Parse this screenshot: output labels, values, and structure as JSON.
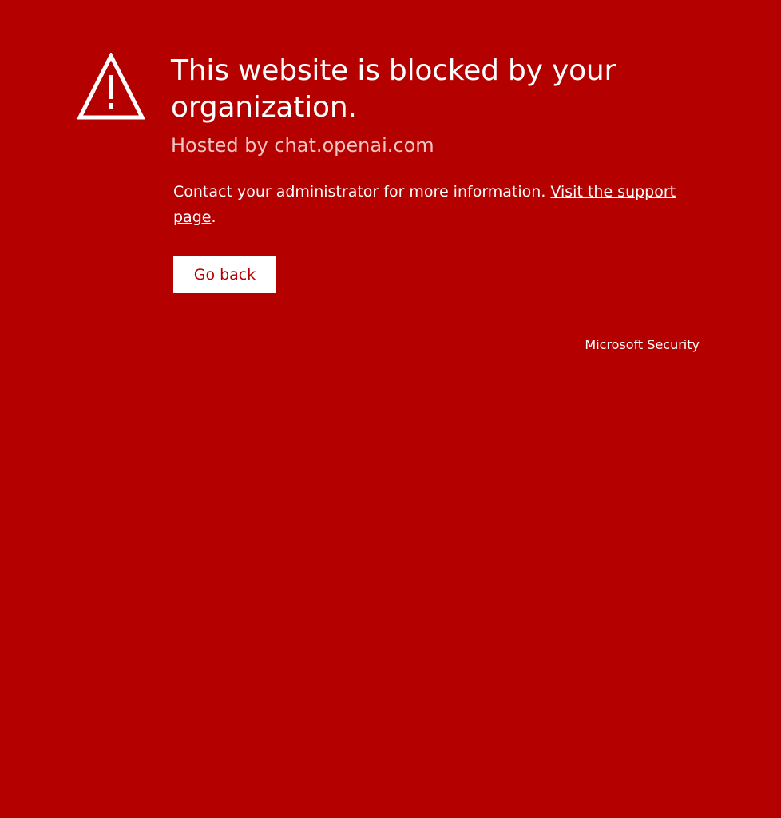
{
  "title": "This website is blocked by your organization.",
  "hosted_by": "Hosted by chat.openai.com",
  "message": {
    "text": "Contact your administrator for more information. ",
    "link_label": "Visit the support page",
    "suffix": "."
  },
  "go_back_label": "Go back",
  "brand": "Microsoft Security",
  "icon": "warning-icon",
  "colors": {
    "background": "#b50000",
    "text": "#ffffff",
    "hosted_text": "#f2c6c6",
    "button_text": "#b50000"
  }
}
